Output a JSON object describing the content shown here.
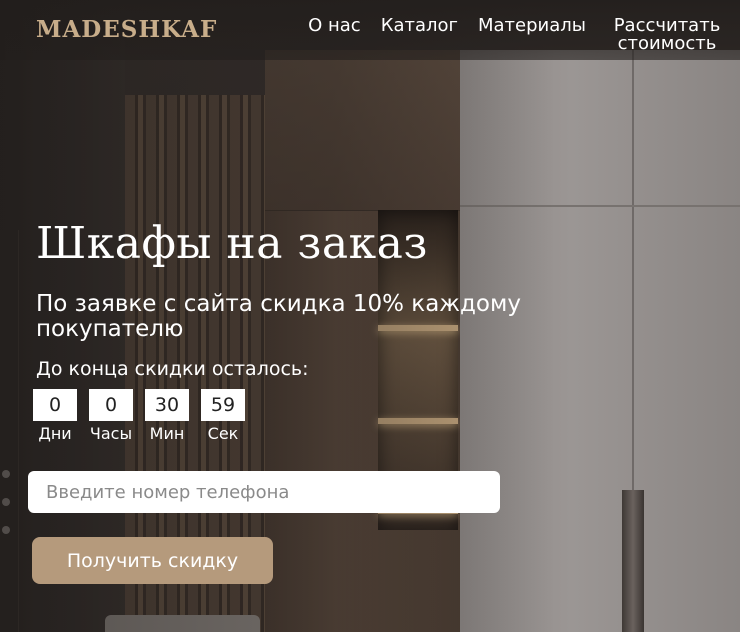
{
  "logo": "MADESHKAF",
  "nav": {
    "about": "О нас",
    "catalog": "Каталог",
    "materials": "Материалы",
    "calculate_line1": "Рассчитать",
    "calculate_line2": "стоимость"
  },
  "hero": {
    "title": "Шкафы на заказ",
    "subtitle": "По заявке с сайта скидка 10% каждому покупателю"
  },
  "countdown": {
    "label": "До конца скидки осталось:",
    "days": {
      "value": "0",
      "caption": "Дни"
    },
    "hours": {
      "value": "0",
      "caption": "Часы"
    },
    "minutes": {
      "value": "30",
      "caption": "Мин"
    },
    "seconds": {
      "value": "59",
      "caption": "Сек"
    }
  },
  "form": {
    "phone_placeholder": "Введите номер телефона",
    "submit_label": "Получить скидку"
  },
  "colors": {
    "accent": "#b59a7c",
    "logo": "#c8ad8a"
  }
}
